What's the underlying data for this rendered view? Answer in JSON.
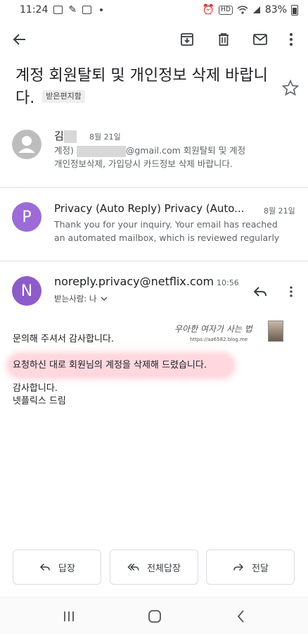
{
  "status_bar": {
    "time": "11:24",
    "hd": "HD",
    "battery_percent": "83%"
  },
  "subject": {
    "text": "계정 회원탈퇴 및 개인정보 삭제 바랍니다.",
    "label": "받은편지함"
  },
  "thread": [
    {
      "sender": "김",
      "date": "8월 21일",
      "snippet_line1_prefix": "계정)",
      "snippet_line1_suffix": "@gmail.com 회원탈퇴 및 계정",
      "snippet_line2": "개인정보삭제, 가입당시 카드정보 삭제 바랍니다.",
      "avatar_letter": "",
      "avatar_color": "#bdbdbd"
    },
    {
      "sender": "Privacy (Auto Reply) Privacy (Auto...",
      "date": "8월 21일",
      "snippet_line1": "Thank you for your inquiry. Your email has reached",
      "snippet_line2": "an automated mailbox, which is reviewed regularly",
      "avatar_letter": "P",
      "avatar_color": "#9c6bd6"
    }
  ],
  "open_message": {
    "avatar_letter": "N",
    "avatar_color": "#8e5cc9",
    "sender": "noreply.privacy@netflix.com",
    "time": "10:56",
    "recipient": "받는사람: 나",
    "body_line1": "문의해 주셔서 감사합니다.",
    "body_highlight": "요청하신 대로 회원님의 계정을 삭제해 드렸습니다.",
    "body_line3": "감사합니다.",
    "body_line4": "넷플릭스 드림",
    "watermark": "우아한 여자가 사는 법",
    "watermark_url": "https://aa6582.blog.me"
  },
  "actions": {
    "reply": "답장",
    "reply_all": "전체답장",
    "forward": "전달"
  },
  "icons": [
    "back-icon",
    "archive-icon",
    "delete-icon",
    "mail-icon",
    "more-icon",
    "star-icon",
    "reply-icon",
    "reply-all-icon",
    "forward-icon"
  ]
}
